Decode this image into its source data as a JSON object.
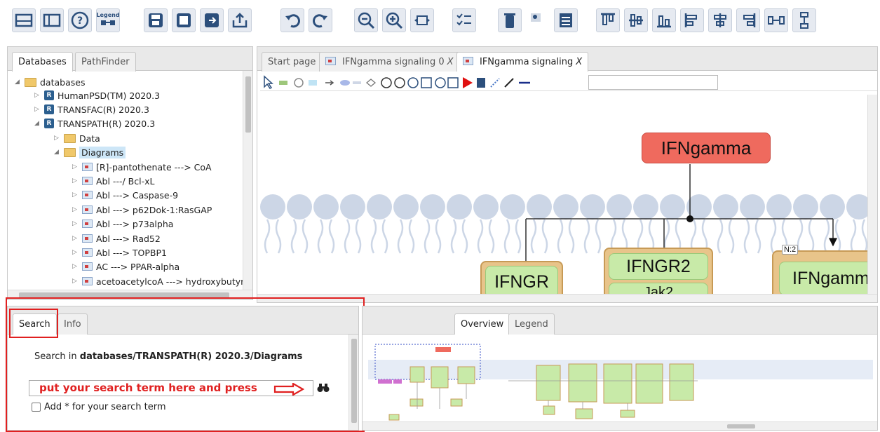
{
  "toolbar": {
    "legend_label": "Legend",
    "buttons": [
      "layout-icon",
      "panel-icon",
      "help-icon",
      "legend-icon",
      "save-icon",
      "save-as-icon",
      "export-icon",
      "upload-icon",
      "undo-icon",
      "redo-icon",
      "zoom-out-icon",
      "zoom-in-icon",
      "fit-icon",
      "checklist-icon",
      "delete-icon",
      "image-icon",
      "table-icon",
      "align-top-icon",
      "align-center-icon",
      "align-bottom-icon",
      "align-left-icon",
      "align-middle-icon",
      "align-right-icon",
      "distribute-h-icon",
      "distribute-v-icon"
    ]
  },
  "left_panel": {
    "tabs": [
      "Databases",
      "PathFinder"
    ],
    "tree": {
      "root": "databases",
      "db1": "HumanPSD(TM) 2020.3",
      "db2": "TRANSFAC(R) 2020.3",
      "db3": "TRANSPATH(R) 2020.3",
      "data_folder": "Data",
      "diagrams_folder": "Diagrams",
      "items": [
        "[R]-pantothenate ---> CoA",
        "Abl ---/ Bcl-xL",
        "Abl ---> Caspase-9",
        "Abl ---> p62Dok-1:RasGAP",
        "Abl ---> p73alpha",
        "Abl ---> Rad52",
        "Abl ---> TOPBP1",
        "AC ---> PPAR-alpha",
        "acetoacetylcoA ---> hydroxybutyr"
      ]
    }
  },
  "editor": {
    "tabs": [
      "Start page",
      "IFNgamma signaling 0",
      "IFNgamma signaling"
    ],
    "close_glyph": "X",
    "nodes": {
      "ligand": "IFNgamma",
      "receptor1": "IFNGR",
      "receptor2": "IFNGR2",
      "complex": "IFNgamm",
      "complex_badge": "N:2",
      "partial": "Jak2"
    }
  },
  "search_panel": {
    "tabs": [
      "Search",
      "Info"
    ],
    "search_in_prefix": "Search in ",
    "search_in_path": "databases/TRANSPATH(R) 2020.3/Diagrams",
    "annotation": "put your search term here and press",
    "checkbox_label": "Add * for your search term"
  },
  "overview_panel": {
    "tabs": [
      "Overview",
      "Legend"
    ]
  },
  "colors": {
    "accent_red": "#e02020",
    "node_green": "#c8eaa8",
    "node_red": "#ef6a5e",
    "membrane": "#ccd6e6"
  }
}
